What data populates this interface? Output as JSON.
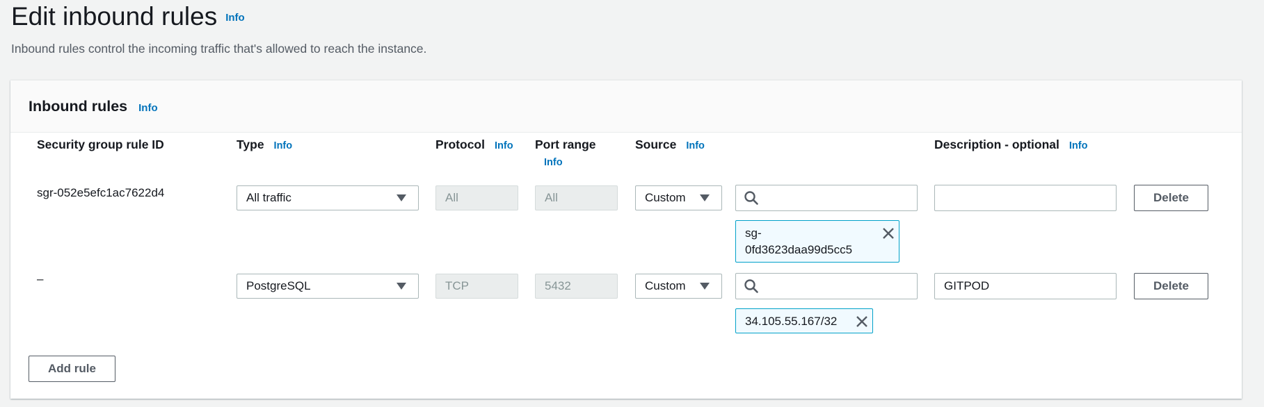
{
  "page": {
    "title": "Edit inbound rules",
    "title_info": "Info",
    "description": "Inbound rules control the incoming traffic that's allowed to reach the instance."
  },
  "panel": {
    "title": "Inbound rules",
    "title_info": "Info"
  },
  "columns": {
    "rule_id": "Security group rule ID",
    "type": "Type",
    "type_info": "Info",
    "protocol": "Protocol",
    "protocol_info": "Info",
    "port_range": "Port range",
    "port_range_info": "Info",
    "source": "Source",
    "source_info": "Info",
    "description": "Description - optional",
    "description_info": "Info"
  },
  "rules": [
    {
      "rule_id": "sgr-052e5efc1ac7622d4",
      "type": "All traffic",
      "protocol": "All",
      "port_range": "All",
      "source_type": "Custom",
      "source_search": "",
      "source_token_line1": "sg-",
      "source_token_line2": "0fd3623daa99d5cc5",
      "description": "",
      "delete_label": "Delete"
    },
    {
      "rule_id": "–",
      "type": "PostgreSQL",
      "protocol": "TCP",
      "port_range": "5432",
      "source_type": "Custom",
      "source_search": "",
      "source_token": "34.105.55.167/32",
      "description": "GITPOD",
      "delete_label": "Delete"
    }
  ],
  "add_rule_label": "Add rule",
  "icons": {
    "search": "search-icon",
    "dropdown": "caret-down-icon",
    "remove": "close-icon"
  },
  "colors": {
    "link": "#0073bb",
    "token_border": "#00a1c9",
    "token_bg": "#f1faff",
    "page_bg": "#f2f3f3"
  }
}
